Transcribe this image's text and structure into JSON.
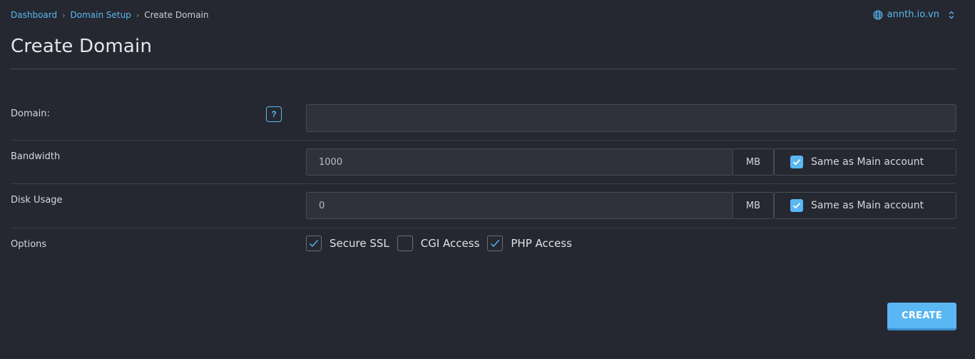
{
  "breadcrumb": {
    "items": [
      "Dashboard",
      "Domain Setup"
    ],
    "current": "Create Domain"
  },
  "domain_selector": {
    "value": "annth.io.vn",
    "icon": "globe-icon",
    "chevron": "chevron-updown-icon"
  },
  "page": {
    "title": "Create Domain"
  },
  "form": {
    "domain": {
      "label": "Domain:",
      "value": "",
      "help": "?"
    },
    "bandwidth": {
      "label": "Bandwidth",
      "value": "1000",
      "unit": "MB",
      "same_label": "Same as Main account",
      "same_checked": true
    },
    "disk": {
      "label": "Disk Usage",
      "value": "0",
      "unit": "MB",
      "same_label": "Same as Main account",
      "same_checked": true
    },
    "options": {
      "label": "Options",
      "items": [
        {
          "label": "Secure SSL",
          "checked": true
        },
        {
          "label": "CGI Access",
          "checked": false
        },
        {
          "label": "PHP Access",
          "checked": true
        }
      ]
    }
  },
  "actions": {
    "create_label": "CREATE"
  },
  "colors": {
    "background": "#252830",
    "accent": "#5bb7f3",
    "input_bg": "#2f323a",
    "border": "#474b54"
  }
}
